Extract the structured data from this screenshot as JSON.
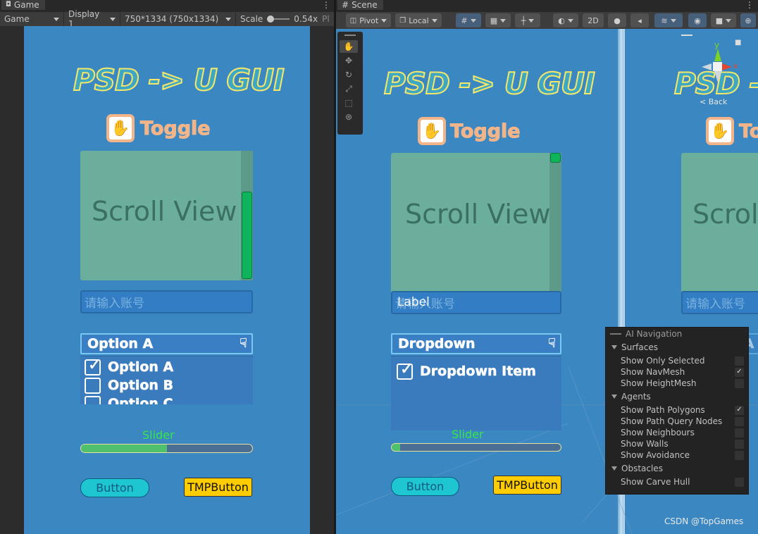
{
  "game": {
    "tab_label": "Game",
    "toolbar": {
      "mode": "Game",
      "display": "Display 1",
      "resolution": "750*1334 (750x1334)",
      "scale_label": "Scale",
      "scale_value": "0.54x",
      "play_fragment": "Pl"
    }
  },
  "scene": {
    "tab_label": "Scene",
    "toolbar": {
      "pivot": "Pivot",
      "local": "Local",
      "mode_2d": "2D"
    },
    "gizmo_back": "< Back"
  },
  "ui": {
    "title": "PSD -> U GUI",
    "toggle_title": "Toggle",
    "scrollview_text": "Scroll View",
    "input_placeholder": "请输入账号",
    "input_label_scene": "Label",
    "dropdown_selected": "Option A",
    "dropdown_options": [
      "Option A",
      "Option B",
      "Option C"
    ],
    "dropdown_scene_head": "Dropdown",
    "dropdown_scene_item": "Dropdown Item",
    "slider_label": "Slider",
    "slider_value_game": 0.5,
    "slider_value_scene": 0.05,
    "button_label": "Button",
    "tmp_button_label": "TMPButton"
  },
  "ai_navigation": {
    "title": "AI Navigation",
    "sections": [
      {
        "name": "Surfaces",
        "items": [
          {
            "label": "Show Only Selected",
            "checked": false
          },
          {
            "label": "Show NavMesh",
            "checked": true
          },
          {
            "label": "Show HeightMesh",
            "checked": false
          }
        ]
      },
      {
        "name": "Agents",
        "items": [
          {
            "label": "Show Path Polygons",
            "checked": true
          },
          {
            "label": "Show Path Query Nodes",
            "checked": false
          },
          {
            "label": "Show Neighbours",
            "checked": false
          },
          {
            "label": "Show Walls",
            "checked": false
          },
          {
            "label": "Show Avoidance",
            "checked": false
          }
        ]
      },
      {
        "name": "Obstacles",
        "items": [
          {
            "label": "Show Carve Hull",
            "checked": false
          }
        ]
      }
    ]
  },
  "watermark": "CSDN @TopGames",
  "colors": {
    "canvas_blue": "#3b87c2",
    "title_fill": "#3ea7c4",
    "title_outline": "#f6e768",
    "toggle_orange": "#f2b58a",
    "scrollview_green": "#6cae9c",
    "scrollbar_green": "#0fb35a",
    "slider_fill": "#4fc16d",
    "slider_label": "#35e648",
    "button_cyan": "#1ec6d2",
    "button_yellow": "#ffcc00"
  }
}
